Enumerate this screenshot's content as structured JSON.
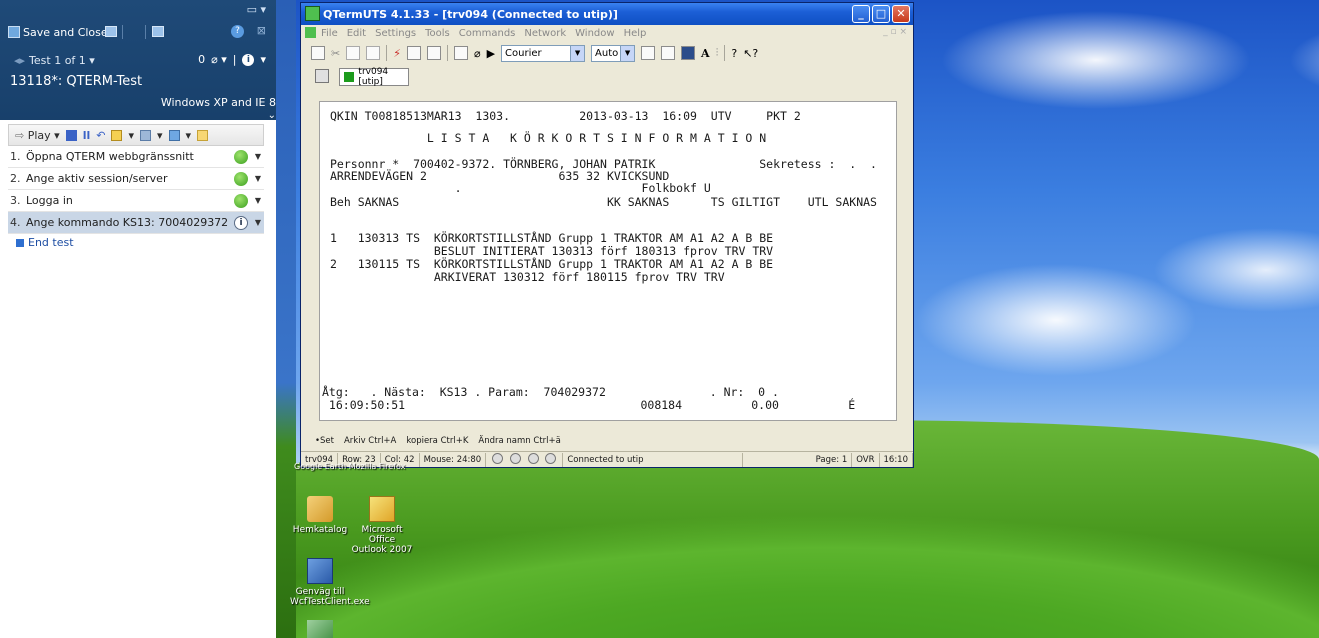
{
  "left_panel": {
    "save_close": "Save and Close",
    "test_nav": "Test 1 of 1",
    "counter": "0",
    "test_title": "13118*: QTERM-Test",
    "test_config": "Windows XP and IE 8",
    "toolbar": {
      "play": "Play"
    },
    "steps": [
      {
        "num": "1.",
        "label": "Öppna QTERM webbgränssnitt",
        "status": "passed"
      },
      {
        "num": "2.",
        "label": "Ange aktiv session/server",
        "status": "passed"
      },
      {
        "num": "3.",
        "label": "Logga in",
        "status": "passed"
      },
      {
        "num": "4.",
        "label": "Ange kommando KS13: 7004029372",
        "status": "active"
      }
    ],
    "end_test": "End test"
  },
  "window": {
    "title": "QTermUTS 4.1.33 - [trv094 (Connected to utip)]",
    "menu": [
      "File",
      "Edit",
      "Settings",
      "Tools",
      "Commands",
      "Network",
      "Window",
      "Help"
    ],
    "font_combo": "Courier",
    "size_combo": "Auto",
    "tab_label": "trv094 [utip]",
    "terminal_lines": [
      "QKIN T00818513MAR13  1303.          2013-03-13  16:09  UTV     PKT 2",
      "              L I S T A   K Ö R K O R T S I N F O R M A T I O N",
      "Personnr *  700402-9372. TÖRNBERG, JOHAN PATRIK               Sekretess :  .  .",
      "ARRENDEVÄGEN 2                   635 32 KVICKSUND",
      "                  .                          Folkbokf U",
      "Beh SAKNAS                              KK SAKNAS      TS GILTIGT    UTL SAKNAS",
      "1   130313 TS  KÖRKORTSTILLSTÅND Grupp 1 TRAKTOR AM A1 A2 A B BE",
      "               BESLUT INITIERAT 130313 förf 180313 fprov TRV TRV",
      "2   130115 TS  KÖRKORTSTILLSTÅND Grupp 1 TRAKTOR AM A1 A2 A B BE",
      "               ARKIVERAT 130312 förf 180115 fprov TRV TRV",
      "Åtg:   . Nästa:  KS13 . Param:  704029372               . Nr:  0 .",
      " 16:09:50:51                                  008184          0.00          É"
    ],
    "fkeys": [
      "•Set",
      "Arkiv Ctrl+A",
      "kopiera Ctrl+K",
      "Ändra namn Ctrl+ä"
    ],
    "status": {
      "session": "trv094",
      "row": "Row: 23",
      "col": "Col: 42",
      "mouse": "Mouse: 24:80",
      "connection": "Connected to utip",
      "page": "Page: 1",
      "mode": "OVR",
      "time": "16:10"
    }
  },
  "desktop": {
    "icons": [
      {
        "label": "Hemkatalog"
      },
      {
        "label": "Microsoft Office Outlook 2007"
      },
      {
        "label": "Genväg till WcfTestClient.exe"
      }
    ],
    "partial_text": "Google Earth    Mozilla Firefox"
  }
}
